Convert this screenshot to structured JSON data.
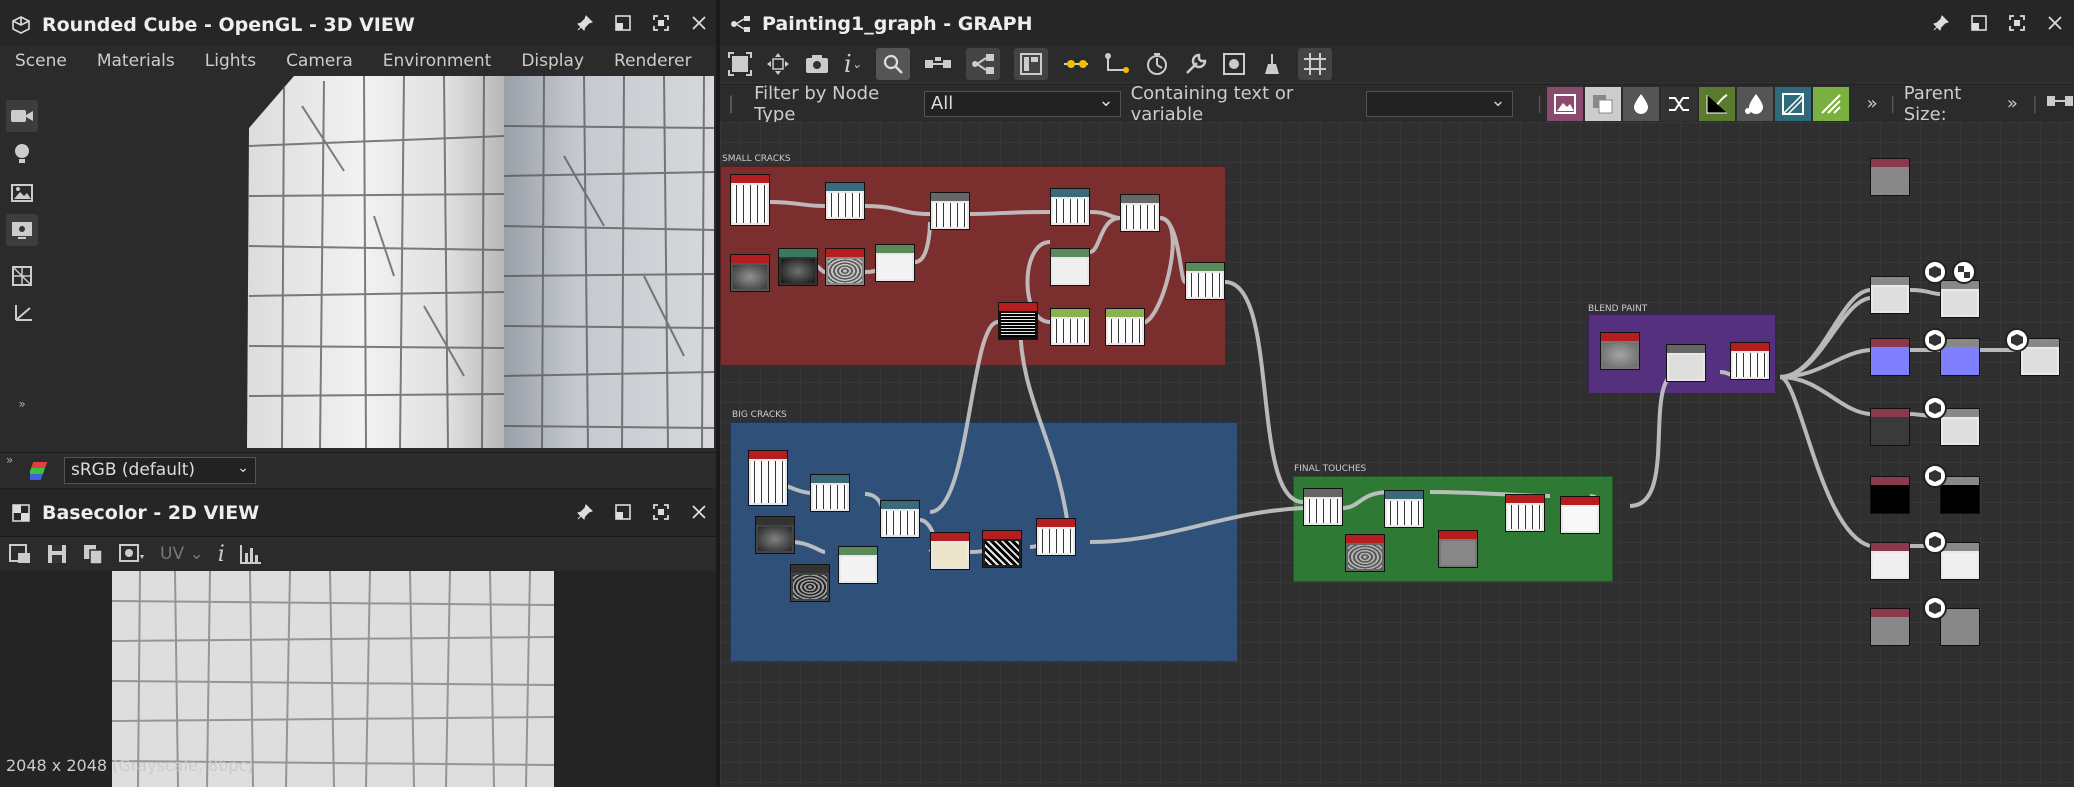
{
  "left_top": {
    "title": "Rounded Cube - OpenGL - 3D VIEW",
    "menu": [
      "Scene",
      "Materials",
      "Lights",
      "Camera",
      "Environment",
      "Display",
      "Renderer"
    ]
  },
  "colorspace": {
    "value": "sRGB (default)"
  },
  "left_bottom": {
    "title": "Basecolor - 2D VIEW",
    "uv_label": "UV",
    "status": "2048 x 2048 (Grayscale, 8bpc)"
  },
  "graph": {
    "title": "Painting1_graph - GRAPH",
    "filter_label": "Filter by Node Type",
    "filter_value": "All",
    "containing_label": "Containing text or variable",
    "containing_value": "",
    "parent_size": "Parent Size:",
    "groups": {
      "small": "SMALL CRACKS",
      "big": "BIG CRACKS",
      "final": "FINAL TOUCHES",
      "blend": "BLEND PAINT"
    }
  },
  "colors": {
    "small_group": "#7a2e2e",
    "big_group": "#2f5079",
    "final_group": "#2e7a35",
    "blend_group": "#55307f",
    "graph_bg": "#2f2f2f"
  }
}
